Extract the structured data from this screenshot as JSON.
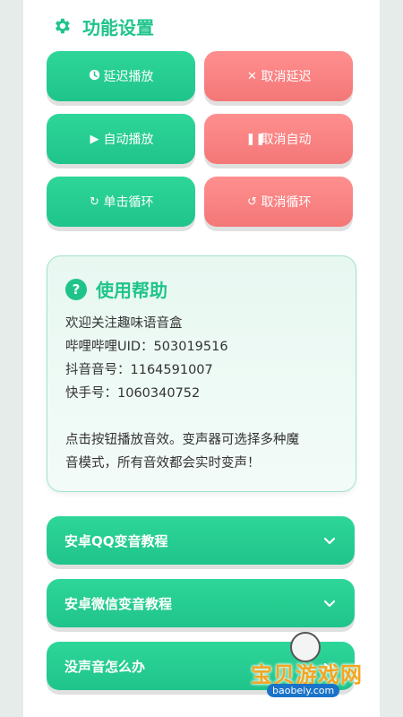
{
  "settings": {
    "title": "功能设置",
    "icon": "gear-icon",
    "buttons": [
      {
        "label": "延迟播放",
        "icon": "clock-icon",
        "color": "#1fc48a"
      },
      {
        "label": "取消延迟",
        "icon": "x-icon",
        "color": "#f47777"
      },
      {
        "label": "自动播放",
        "icon": "play-icon",
        "color": "#1fc48a"
      },
      {
        "label": "取消自动",
        "icon": "pause-icon",
        "color": "#f47777"
      },
      {
        "label": "单击循环",
        "icon": "redo-icon",
        "color": "#1fc48a"
      },
      {
        "label": "取消循环",
        "icon": "undo-icon",
        "color": "#f47777"
      }
    ]
  },
  "help": {
    "title": "使用帮助",
    "icon": "question-icon",
    "lines": [
      "欢迎关注趣味语音盒",
      "哔哩哔哩UID：503019516",
      "抖音音号：1164591007",
      "快手号：1060340752",
      "",
      "点击按钮播放音效。变声器可选择多种魔",
      "音模式，所有音效都会实时变声！"
    ]
  },
  "accordions": [
    {
      "label": "安卓QQ变音教程"
    },
    {
      "label": "安卓微信变音教程"
    },
    {
      "label": "没声音怎么办"
    }
  ],
  "watermark": {
    "text": "宝贝游戏网",
    "url": "baobeiy.com"
  },
  "colors": {
    "accent": "#1fc48a",
    "danger": "#f47777"
  }
}
